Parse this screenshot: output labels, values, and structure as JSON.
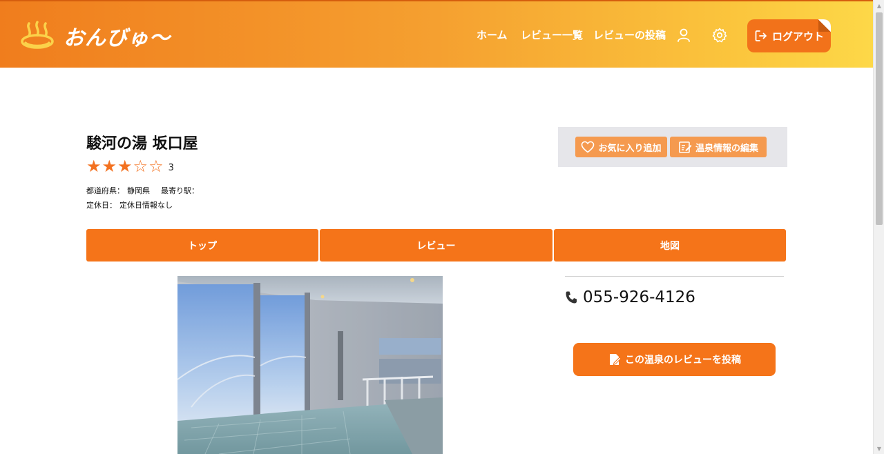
{
  "brand": {
    "name": "おんびゅ〜",
    "icon": "hot-spring-icon"
  },
  "nav": {
    "home": "ホーム",
    "review_list": "レビュー一覧",
    "post_review": "レビューの投稿",
    "profile_icon": "user-icon",
    "settings_icon": "gear-icon",
    "logout": "ログアウト"
  },
  "onsen": {
    "name": "駿河の湯 坂口屋",
    "rating": 3,
    "rating_max": 5,
    "rating_text": "3",
    "prefecture_label": "都道府県：",
    "prefecture": "静岡県",
    "station_label": "最寄り駅：",
    "station": "",
    "closed_label": "定休日：",
    "closed": "定休日情報なし",
    "phone": "055-926-4126"
  },
  "actions": {
    "favorite": "お気に入り追加",
    "edit": "温泉情報の編集"
  },
  "tabs": [
    {
      "label": "トップ"
    },
    {
      "label": "レビュー"
    },
    {
      "label": "地図"
    }
  ],
  "review_button": "この温泉のレビューを投稿",
  "colors": {
    "accent": "#f57419",
    "header_start": "#f07d1d",
    "header_end": "#fdd848",
    "action_box": "#e6e6ea",
    "action_button": "#f59a4f"
  }
}
